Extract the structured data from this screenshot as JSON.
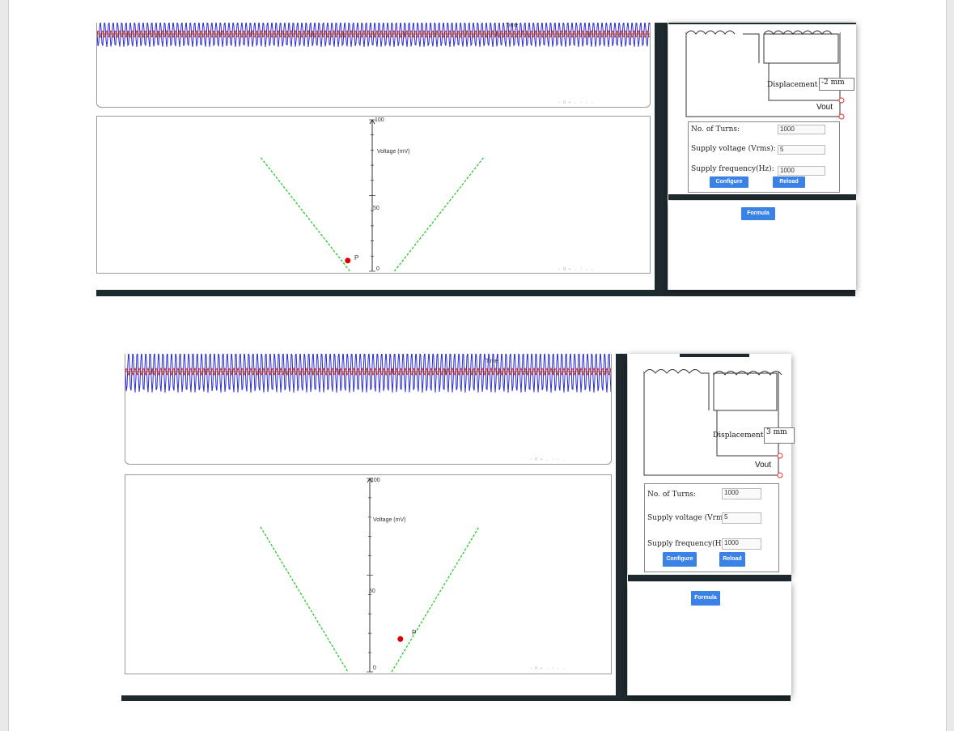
{
  "panels": [
    {
      "id": "top",
      "waveform_axis_label": "Time",
      "chart": {
        "ylabel": "Voltage (mV)",
        "yticks": [
          "100",
          "50",
          "0"
        ],
        "point_label": "P"
      },
      "form": {
        "turns_label": "No. of Turns:",
        "turns_value": "1000",
        "supply_voltage_label": "Supply voltage (Vrms):",
        "supply_voltage_value": "5",
        "supply_freq_label": "Supply frequency(Hz):",
        "supply_freq_value": "1000",
        "configure_label": "Configure",
        "reload_label": "Reload"
      },
      "displacement_label": "Displacement",
      "displacement_value": "-2 mm",
      "vout_label": "Vout",
      "formula_label": "Formula",
      "nav_controls": "− 0 + ← ↑ ↓ →"
    },
    {
      "id": "bottom",
      "waveform_axis_label": "Time",
      "chart": {
        "ylabel": "Voltage (mV)",
        "yticks": [
          "100",
          "50",
          "0"
        ],
        "point_label": "P"
      },
      "form": {
        "turns_label": "No. of Turns:",
        "turns_value": "1000",
        "supply_voltage_label": "Supply voltage (Vrms):",
        "supply_voltage_value": "5",
        "supply_freq_label": "Supply frequency(Hz):",
        "supply_freq_value": "1000",
        "configure_label": "Configure",
        "reload_label": "Reload"
      },
      "displacement_label": "Displacement",
      "displacement_value": "3 mm",
      "vout_label": "Vout",
      "formula_label": "Formula",
      "nav_controls": "− 0 + ← ↑ ↓ →"
    }
  ],
  "chart_data": [
    {
      "type": "line",
      "ylabel": "Voltage (mV)",
      "ylim": [
        0,
        100
      ],
      "series": [
        {
          "x": [
            -5,
            -1
          ],
          "values": [
            75,
            0
          ]
        },
        {
          "x": [
            1,
            5
          ],
          "values": [
            0,
            75
          ]
        }
      ],
      "point": {
        "x": -1.1,
        "y": 7,
        "label": "P"
      }
    },
    {
      "type": "line",
      "ylabel": "Voltage (mV)",
      "ylim": [
        0,
        100
      ],
      "series": [
        {
          "x": [
            -5,
            -1
          ],
          "values": [
            75,
            0
          ]
        },
        {
          "x": [
            1,
            5
          ],
          "values": [
            0,
            75
          ]
        }
      ],
      "point": {
        "x": 1.4,
        "y": 17,
        "label": "P"
      }
    }
  ],
  "colors": {
    "dark_bar": "#1f2a2e",
    "button": "#3b82e6",
    "wave_blue": "#2b2bd9",
    "wave_red": "#e02020",
    "dashed_green": "#22cc22",
    "point_red": "#e00000"
  }
}
